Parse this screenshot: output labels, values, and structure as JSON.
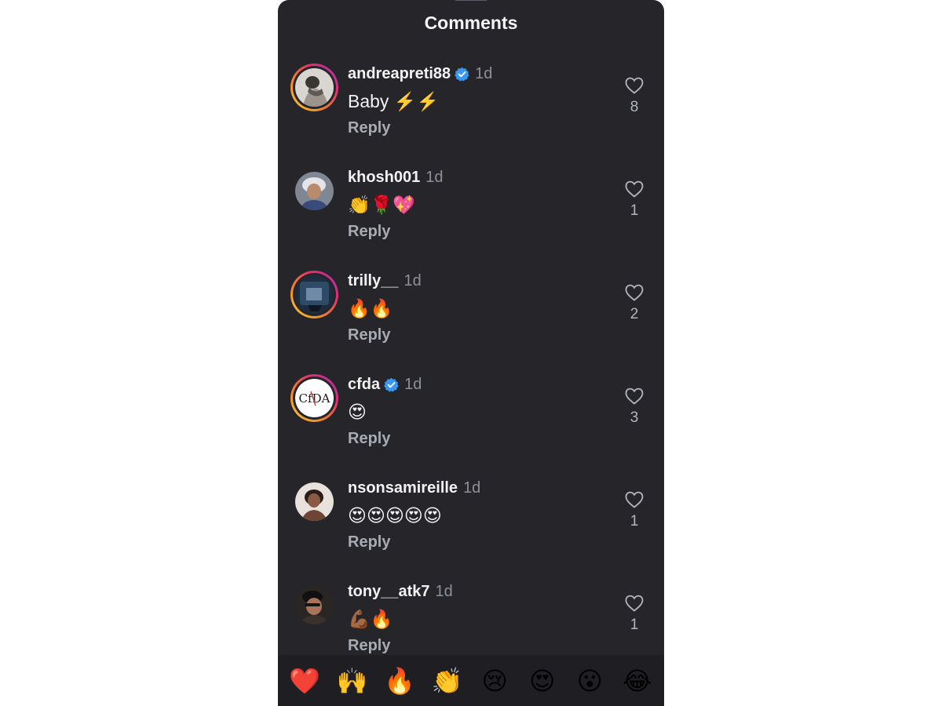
{
  "header": {
    "title": "Comments"
  },
  "comments": [
    {
      "username": "andreapreti88",
      "verified": true,
      "time": "1d",
      "text": "Baby ⚡️⚡️",
      "reply_label": "Reply",
      "likes": "8",
      "story_ring": true
    },
    {
      "username": "khosh001",
      "verified": false,
      "time": "1d",
      "text": "👏🌹💖",
      "reply_label": "Reply",
      "likes": "1",
      "story_ring": false
    },
    {
      "username": "trilly__",
      "verified": false,
      "time": "1d",
      "text": "🔥🔥",
      "reply_label": "Reply",
      "likes": "2",
      "story_ring": true
    },
    {
      "username": "cfda",
      "verified": true,
      "time": "1d",
      "text": "😍",
      "reply_label": "Reply",
      "likes": "3",
      "story_ring": true
    },
    {
      "username": "nsonsamireille",
      "verified": false,
      "time": "1d",
      "text": "😍😍😍😍😍",
      "reply_label": "Reply",
      "likes": "1",
      "story_ring": false
    },
    {
      "username": "tony__atk7",
      "verified": false,
      "time": "1d",
      "text": "💪🏾🔥",
      "reply_label": "Reply",
      "likes": "1",
      "story_ring": false
    }
  ],
  "avatar_logo_text": "CfDA",
  "reactions": [
    "❤️",
    "🙌",
    "🔥",
    "👏",
    "😢",
    "😍",
    "😮",
    "😂"
  ],
  "icons": {
    "like": "heart-outline-icon",
    "verified": "verified-badge-icon"
  },
  "colors": {
    "background": "#25252a",
    "text": "#f2f2f2",
    "muted": "#8e9198",
    "verified_blue": "#3897f0"
  }
}
